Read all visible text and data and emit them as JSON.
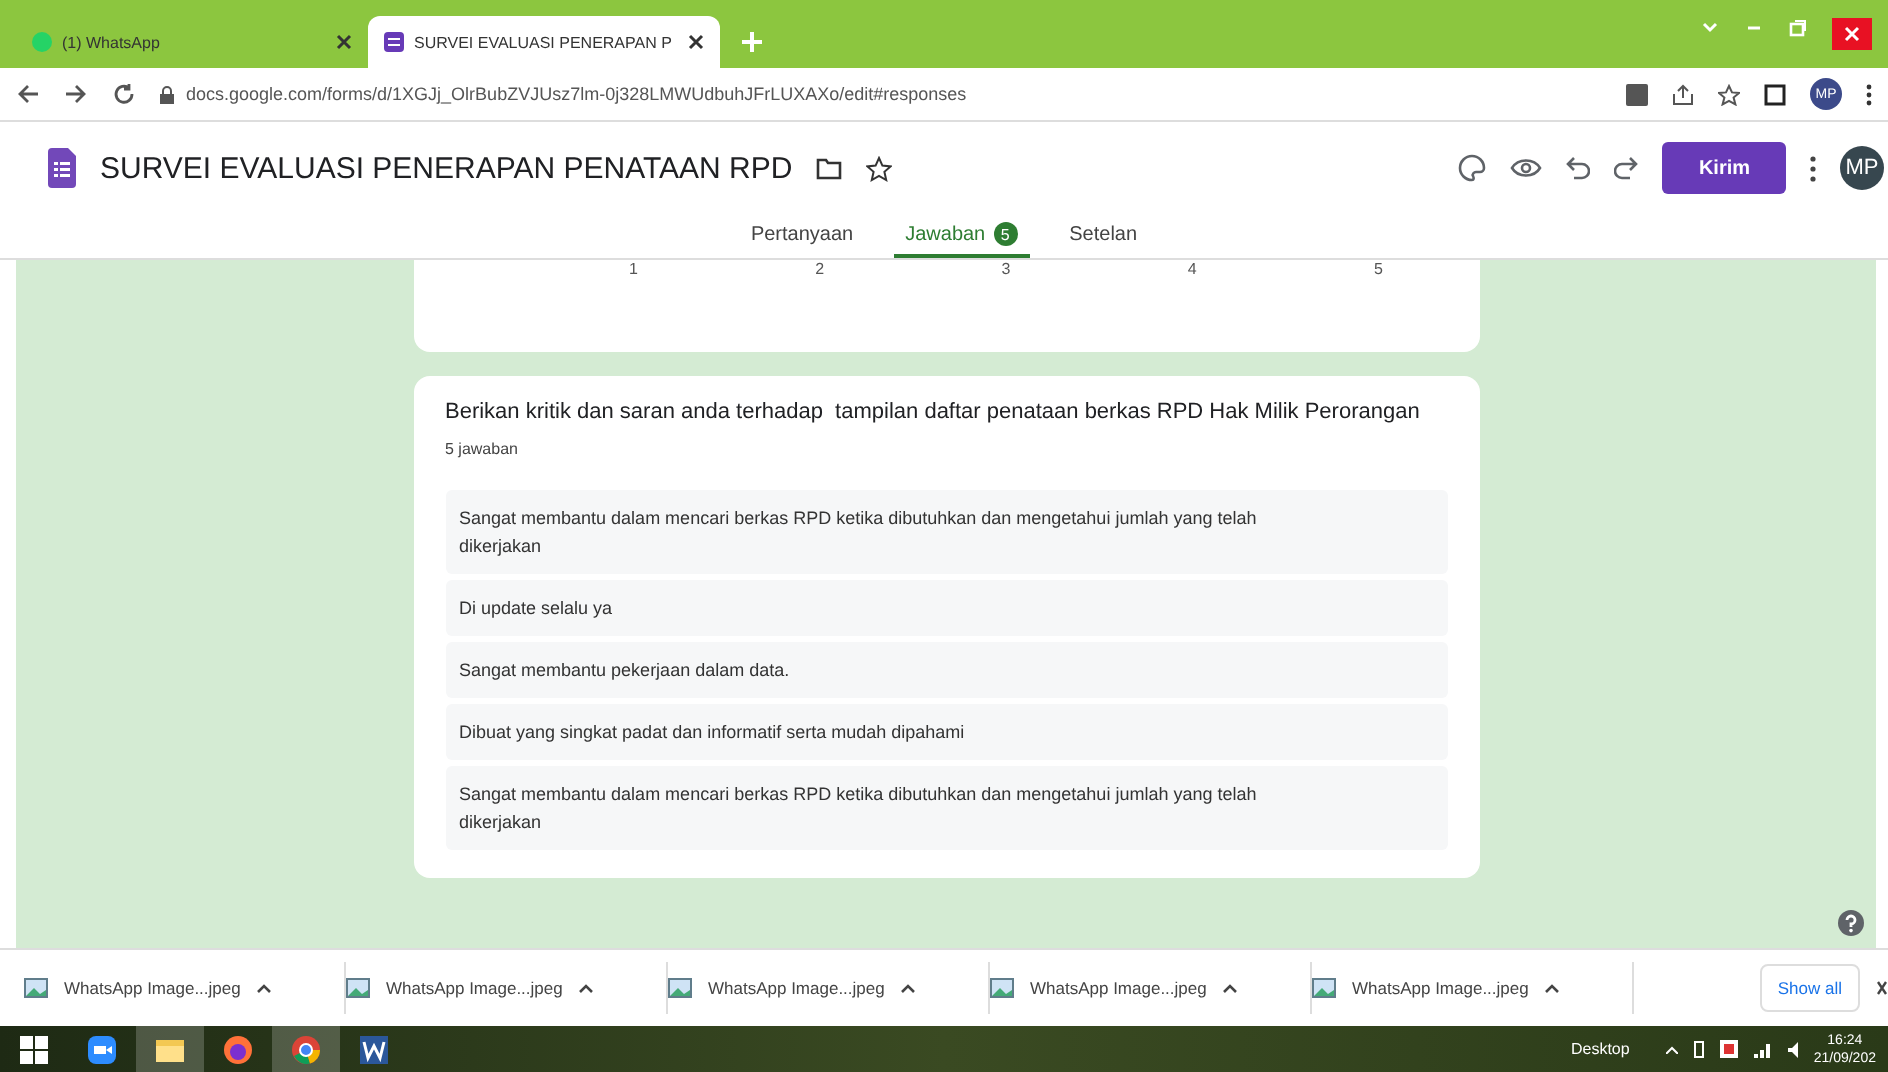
{
  "browser_tabs": [
    {
      "title": "(1) WhatsApp",
      "selected": false
    },
    {
      "title": "SURVEI EVALUASI PENERAPAN P",
      "selected": true
    }
  ],
  "address": "docs.google.com/forms/d/1XGJj_OlrBubZVJUsz7lm-0j328LMWUdbuhJFrLUXAXo/edit#responses",
  "profile": "MP",
  "form": {
    "title": "SURVEI EVALUASI PENERAPAN PENATAAN RPD",
    "send_button": "Kirim",
    "avatar": "MP"
  },
  "form_tabs": [
    {
      "label": "Pertanyaan",
      "selected": false
    },
    {
      "label": "Jawaban",
      "selected": true,
      "badge": "5"
    },
    {
      "label": "Setelan",
      "selected": false
    }
  ],
  "scale_labels": [
    "1",
    "2",
    "3",
    "4",
    "5"
  ],
  "question": {
    "title": "Berikan kritik dan saran anda terhadap  tampilan daftar penataan berkas RPD Hak Milik Perorangan",
    "count": "5 jawaban",
    "answers": [
      "Sangat membantu dalam mencari berkas RPD ketika dibutuhkan dan mengetahui jumlah yang telah dikerjakan",
      "Di update selalu ya",
      "Sangat membantu pekerjaan dalam data.",
      "Dibuat yang singkat padat dan informatif serta mudah dipahami",
      "Sangat membantu dalam mencari berkas RPD ketika dibutuhkan dan mengetahui jumlah yang telah dikerjakan"
    ]
  },
  "downloads": [
    "WhatsApp Image...jpeg",
    "WhatsApp Image...jpeg",
    "WhatsApp Image...jpeg",
    "WhatsApp Image...jpeg",
    "WhatsApp Image...jpeg"
  ],
  "show_all": "Show all",
  "taskbar": {
    "desktop": "Desktop",
    "time": "16:24",
    "date": "21/09/202"
  }
}
